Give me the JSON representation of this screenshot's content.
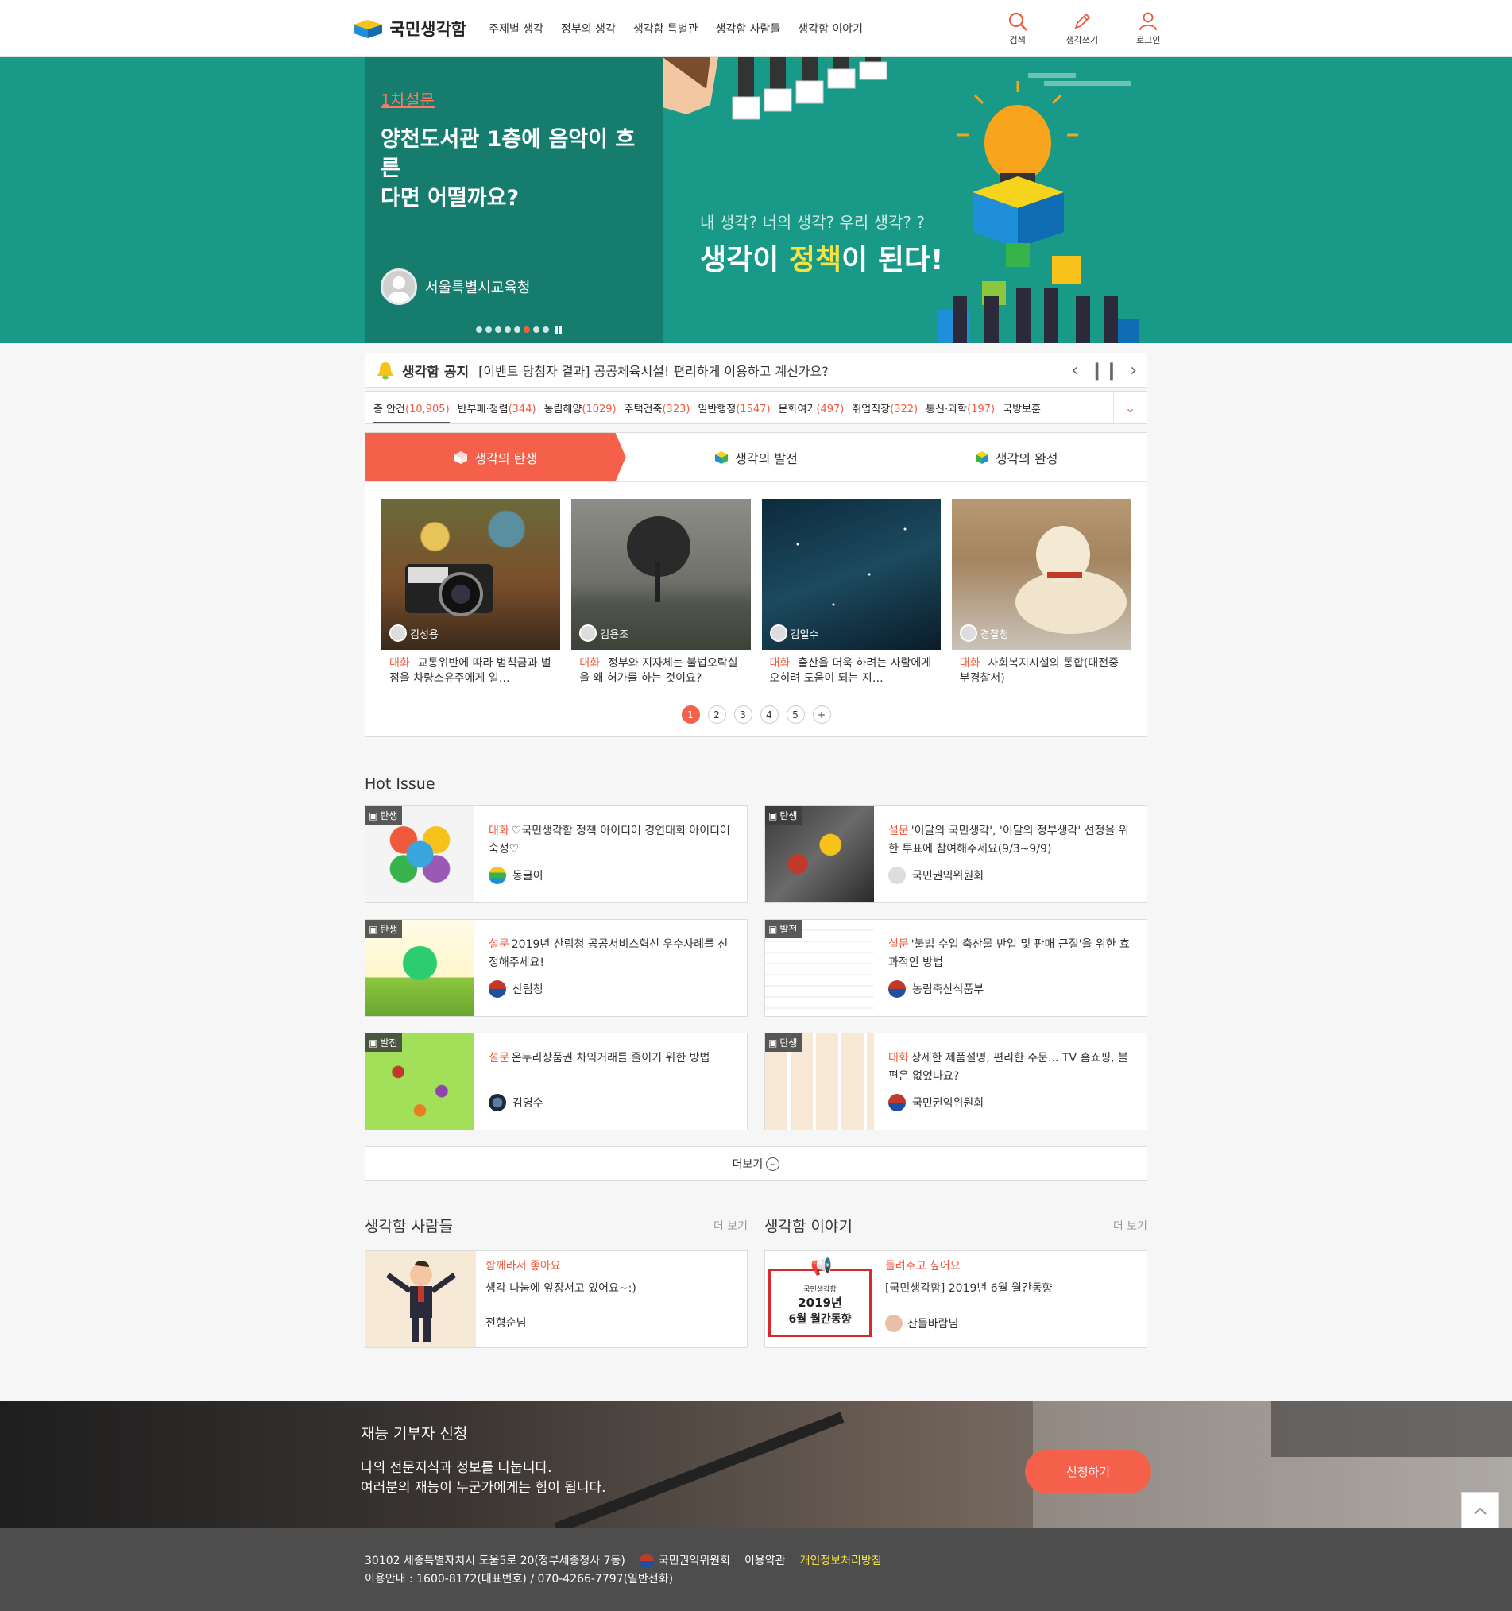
{
  "header": {
    "logo_text": "국민생각함",
    "nav": [
      "주제별 생각",
      "정부의 생각",
      "생각함 특별관",
      "생각함 사람들",
      "생각함 이야기"
    ],
    "util": {
      "search": "검색",
      "write": "생각쓰기",
      "login": "로그인"
    }
  },
  "hero": {
    "category": "1차설문",
    "title_line1": "양천도서관 1층에 음악이 흐른",
    "title_line2": "다면 어떨까요?",
    "author": "서울특별시교육청",
    "tagline": "내 생각? 너의 생각? 우리 생각? ?",
    "main_pre": "생각이 ",
    "main_em": "정책",
    "main_post": "이 된다!",
    "dot_count": 8,
    "active_dot": 5
  },
  "notice": {
    "label": "생각함 공지",
    "text": "[이벤트 당첨자 결과] 공공체육시설! 편리하게 이용하고 계신가요?"
  },
  "categories": [
    {
      "name": "총 안건",
      "count": "(10,905)"
    },
    {
      "name": "반부패·청렴",
      "count": "(344)"
    },
    {
      "name": "농림해양",
      "count": "(1029)"
    },
    {
      "name": "주택건축",
      "count": "(323)"
    },
    {
      "name": "일반행정",
      "count": "(1547)"
    },
    {
      "name": "문화여가",
      "count": "(497)"
    },
    {
      "name": "취업직장",
      "count": "(322)"
    },
    {
      "name": "통신·과학",
      "count": "(197)"
    },
    {
      "name": "국방보훈",
      "count": ""
    }
  ],
  "stage_tabs": [
    "생각의 탄생",
    "생각의 발전",
    "생각의 완성"
  ],
  "cards": [
    {
      "author": "김성용",
      "type": "대화",
      "desc": "교통위반에 따라 범칙금과 벌점을 차량소유주에게 일…"
    },
    {
      "author": "김용조",
      "type": "대화",
      "desc": "정부와 지자체는 불법오락실을 왜 허가를 하는 것이요?"
    },
    {
      "author": "김일수",
      "type": "대화",
      "desc": "출산을 더욱 하려는 사람에게 오히려 도움이 되는 지…"
    },
    {
      "author": "경찰청",
      "type": "대화",
      "desc": "사회복지시설의 통합(대전중부경찰서)"
    }
  ],
  "pager": [
    "1",
    "2",
    "3",
    "4",
    "5",
    "+"
  ],
  "hot_issue": {
    "title": "Hot Issue",
    "items": [
      {
        "stage": "탄생",
        "type": "대화",
        "title": "♡국민생각함 정책 아이디어 경연대회 아이디어 숙성♡",
        "author": "동글이"
      },
      {
        "stage": "탄생",
        "type": "설문",
        "title": "'이달의 국민생각', '이달의 정부생각' 선정을 위한 투표에 참여해주세요(9/3~9/9)",
        "author": "국민권익위원회"
      },
      {
        "stage": "탄생",
        "type": "설문",
        "title": "2019년 산림청 공공서비스혁신 우수사례를 선정해주세요!",
        "author": "산림청"
      },
      {
        "stage": "발전",
        "type": "설문",
        "title": "'불법 수입 축산물 반입 및 판매 근절'을 위한 효과적인 방법",
        "author": "농림축산식품부"
      },
      {
        "stage": "발전",
        "type": "설문",
        "title": "온누리상품권 차익거래를 줄이기 위한 방법",
        "author": "김영수"
      },
      {
        "stage": "탄생",
        "type": "대화",
        "title": "상세한 제품설명, 편리한 주문... TV 홈쇼핑, 불편은 없었나요?",
        "author": "국민권익위원회"
      }
    ],
    "more": "더보기"
  },
  "people": {
    "title": "생각함 사람들",
    "more": "더 보기",
    "cat": "함께라서 좋아요",
    "text": "생각 나눔에 앞장서고 있어요~:)",
    "author": "전형순님"
  },
  "story": {
    "title": "생각함 이야기",
    "more": "더 보기",
    "cat": "들려주고 싶어요",
    "text": "[국민생각함] 2019년 6월 월간동향",
    "author": "산들바람님",
    "img_brand": "국민생각함",
    "img_line1": "2019년",
    "img_line2": "6월 월간동향"
  },
  "donate": {
    "title": "재능 기부자 신청",
    "line1": "나의 전문지식과 정보를 나눕니다.",
    "line2": "여러분의 재능이 누군가에게는 힘이 됩니다.",
    "button": "신청하기"
  },
  "footer": {
    "address": "30102 세종특별자치시 도움5로 20(정부세종청사 7동)",
    "org": "국민권익위원회",
    "terms": "이용약관",
    "privacy": "개인정보처리방침",
    "contact": "이용안내 : 1600-8172(대표번호) / 070-4266-7797(일반전화)"
  },
  "colors": {
    "accent": "#f4604a",
    "hero_bg": "#199a88",
    "hero_panel": "#157c6e",
    "footer_bg": "#4d4d4d"
  }
}
